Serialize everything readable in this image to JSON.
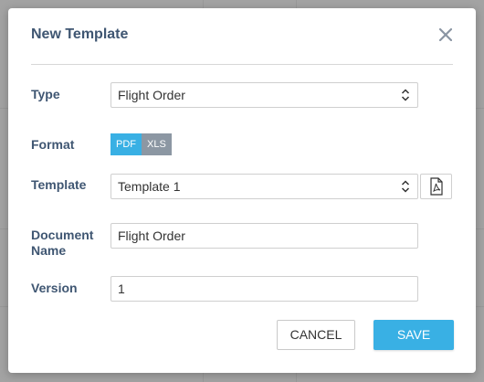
{
  "modal": {
    "title": "New Template",
    "close_icon": "close-icon"
  },
  "fields": {
    "type": {
      "label": "Type",
      "value": "Flight Order"
    },
    "format": {
      "label": "Format",
      "options": [
        "PDF",
        "XLS"
      ],
      "selected": "PDF"
    },
    "template": {
      "label": "Template",
      "value": "Template 1",
      "preview_icon": "pdf-file-icon"
    },
    "document_name": {
      "label_line1": "Document",
      "label_line2": "Name",
      "value": "Flight Order"
    },
    "version": {
      "label": "Version",
      "value": "1"
    }
  },
  "actions": {
    "cancel_label": "CANCEL",
    "save_label": "SAVE"
  },
  "colors": {
    "accent": "#39b0e4",
    "label": "#3f5672",
    "inactive_toggle": "#8c97a3",
    "overlay": "#a3a3a3"
  }
}
